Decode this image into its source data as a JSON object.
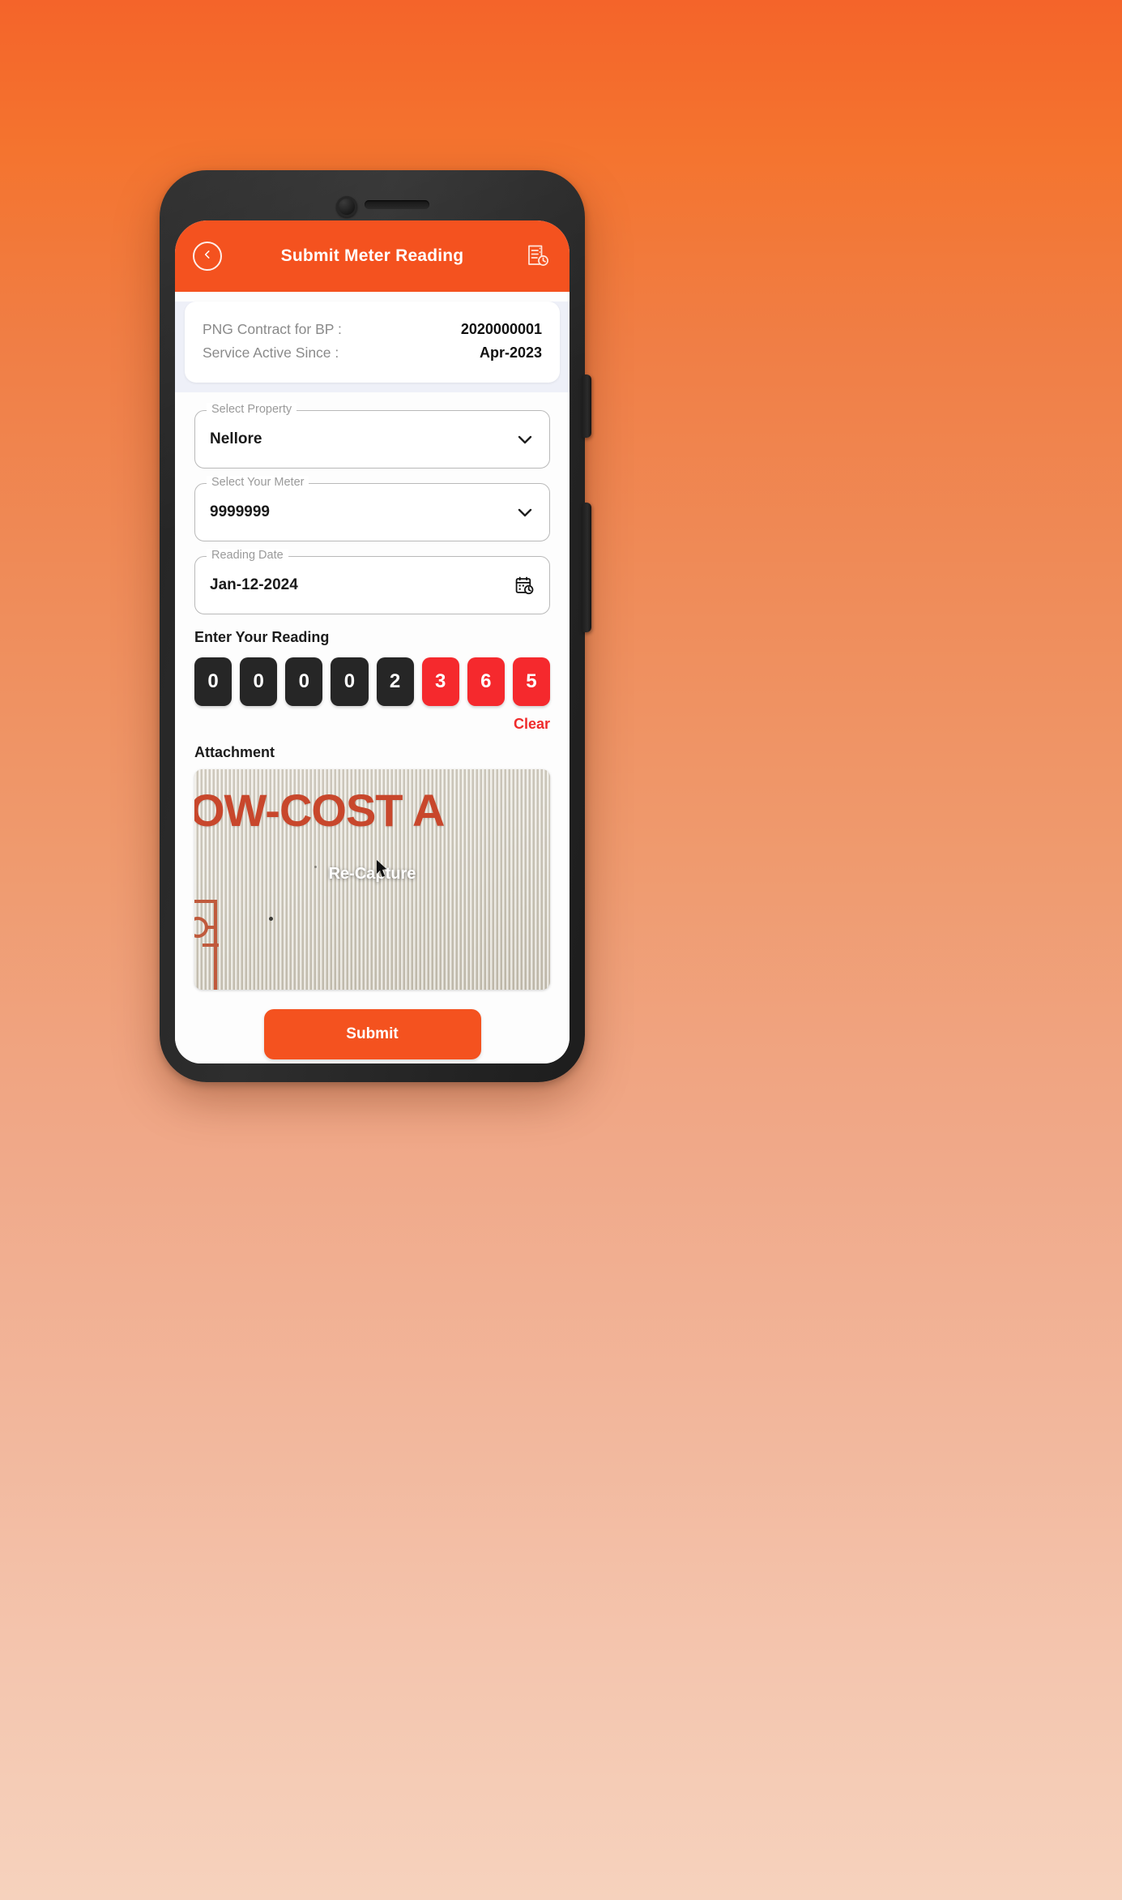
{
  "theme": {
    "accent": "#f4521f",
    "digit_filled": "#262626",
    "digit_highlight": "#f5292d",
    "clear_color": "#ef2b2b",
    "page_background_top": "#f4642a",
    "page_background_bottom": "#f6d2bd"
  },
  "appbar": {
    "title": "Submit Meter Reading",
    "back_icon": "chevron-left-icon",
    "history_icon": "document-history-icon"
  },
  "contract": {
    "rows": [
      {
        "label": "PNG Contract for BP :",
        "value": "2020000001"
      },
      {
        "label": "Service Active Since :",
        "value": "Apr-2023"
      }
    ]
  },
  "form": {
    "fields": [
      {
        "legend": "Select Property",
        "value": "Nellore",
        "trailing_icon": "chevron-down-icon"
      },
      {
        "legend": "Select Your Meter",
        "value": "9999999",
        "trailing_icon": "chevron-down-icon"
      },
      {
        "legend": "Reading Date",
        "value": "Jan-12-2024",
        "trailing_icon": "calendar-clock-icon"
      }
    ]
  },
  "reading": {
    "label": "Enter Your Reading",
    "digits": [
      {
        "value": "0",
        "state": "dark"
      },
      {
        "value": "0",
        "state": "dark"
      },
      {
        "value": "0",
        "state": "dark"
      },
      {
        "value": "0",
        "state": "dark"
      },
      {
        "value": "2",
        "state": "dark"
      },
      {
        "value": "3",
        "state": "red"
      },
      {
        "value": "6",
        "state": "red"
      },
      {
        "value": "5",
        "state": "red"
      }
    ],
    "clear_label": "Clear"
  },
  "attachment": {
    "label": "Attachment",
    "photo_text": "OW-COST A",
    "overlay_label": "Re-Capture"
  },
  "actions": {
    "submit_label": "Submit"
  }
}
